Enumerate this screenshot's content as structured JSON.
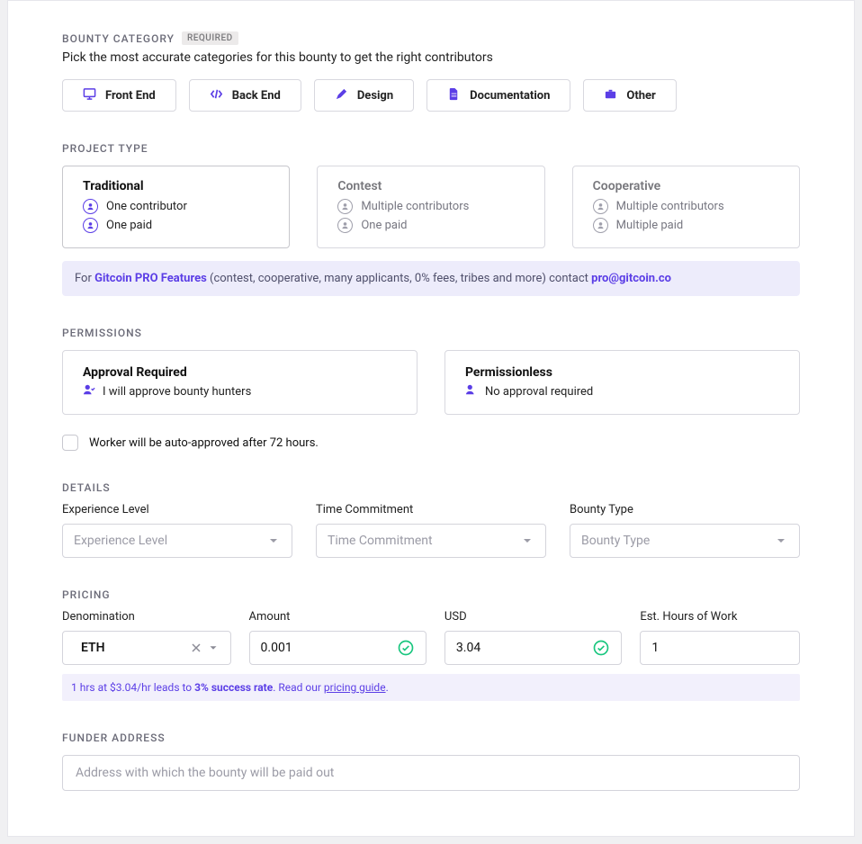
{
  "colors": {
    "accent": "#5b3ee6"
  },
  "bounty_category": {
    "label": "Bounty Category",
    "required_badge": "Required",
    "subtitle": "Pick the most accurate categories for this bounty to get the right contributors",
    "options": [
      {
        "id": "front-end",
        "label": "Front End",
        "icon": "monitor"
      },
      {
        "id": "back-end",
        "label": "Back End",
        "icon": "code"
      },
      {
        "id": "design",
        "label": "Design",
        "icon": "pencil-ruler"
      },
      {
        "id": "documentation",
        "label": "Documentation",
        "icon": "file"
      },
      {
        "id": "other",
        "label": "Other",
        "icon": "briefcase"
      }
    ]
  },
  "project_type": {
    "label": "Project Type",
    "cards": [
      {
        "title": "Traditional",
        "lines": [
          "One contributor",
          "One paid"
        ],
        "selected": true
      },
      {
        "title": "Contest",
        "lines": [
          "Multiple contributors",
          "One paid"
        ],
        "selected": false
      },
      {
        "title": "Cooperative",
        "lines": [
          "Multiple contributors",
          "Multiple paid"
        ],
        "selected": false
      }
    ]
  },
  "pro_banner": {
    "prefix": "For ",
    "brand": "Gitcoin PRO Features",
    "mid": " (contest, cooperative, many applicants, 0% fees, tribes and more) contact ",
    "email": "pro@gitcoin.co"
  },
  "permissions": {
    "label": "Permissions",
    "cards": [
      {
        "title": "Approval Required",
        "line": "I will approve bounty hunters"
      },
      {
        "title": "Permissionless",
        "line": "No approval required"
      }
    ],
    "auto_approve_checkbox": "Worker will be auto-approved after 72 hours."
  },
  "details": {
    "label": "Details",
    "experience": {
      "label": "Experience Level",
      "placeholder": "Experience Level"
    },
    "time": {
      "label": "Time Commitment",
      "placeholder": "Time Commitment"
    },
    "bounty_type": {
      "label": "Bounty Type",
      "placeholder": "Bounty Type"
    }
  },
  "pricing": {
    "label": "Pricing",
    "denomination": {
      "label": "Denomination",
      "value": "ETH"
    },
    "amount": {
      "label": "Amount",
      "value": "0.001"
    },
    "usd": {
      "label": "USD",
      "value": "3.04"
    },
    "hours": {
      "label": "Est. Hours of Work",
      "value": "1"
    },
    "note_prefix": "1 hrs at $3.04/hr leads to ",
    "note_bold": "3% success rate",
    "note_mid": ". Read our ",
    "note_link": "pricing guide",
    "note_suffix": "."
  },
  "funder_address": {
    "label": "Funder Address",
    "placeholder": "Address with which the bounty will be paid out"
  }
}
